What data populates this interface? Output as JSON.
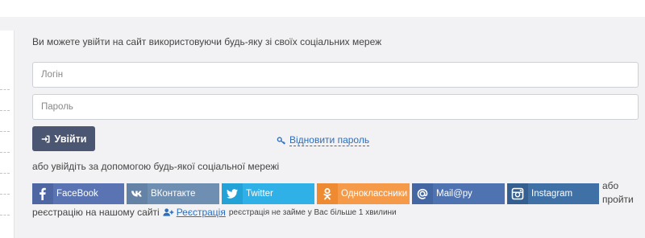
{
  "intro_text": "Ви можете увійти на сайт використовуючи будь-яку зі своїх соціальних мереж",
  "login_field": {
    "placeholder": "Логін",
    "value": ""
  },
  "password_field": {
    "placeholder": "Пароль",
    "value": ""
  },
  "login_button": {
    "label": "Увійти",
    "icon": "sign-in-icon"
  },
  "restore_link": {
    "label": "Відновити пароль",
    "icon": "key-icon"
  },
  "or_social_text": "або увійдіть за допомогою будь-якої соціальної мережі",
  "social_buttons": [
    {
      "id": "facebook",
      "label": "FaceBook",
      "icon": "facebook-icon",
      "color": "#5a74b3"
    },
    {
      "id": "vkontakte",
      "label": "ВКонтакте",
      "icon": "vk-icon",
      "color": "#6e8eb2"
    },
    {
      "id": "twitter",
      "label": "Twitter",
      "icon": "twitter-icon",
      "color": "#2fb0e6"
    },
    {
      "id": "odnoklassniki",
      "label": "Одноклассники",
      "icon": "odnoklassniki-icon",
      "color": "#f59a49"
    },
    {
      "id": "mailru",
      "label": "Mail@ру",
      "icon": "at-icon",
      "color": "#4f73b0"
    },
    {
      "id": "instagram",
      "label": "Instagram",
      "icon": "instagram-icon",
      "color": "#3f70a6"
    }
  ],
  "or_register_text": "або пройти",
  "register_prefix": "реєстрацію на нашому сайті",
  "register_link": {
    "label": "Реєстрація",
    "icon": "user-plus-icon"
  },
  "register_note": "реєстрація не займе у Вас більше 1 хвилини"
}
